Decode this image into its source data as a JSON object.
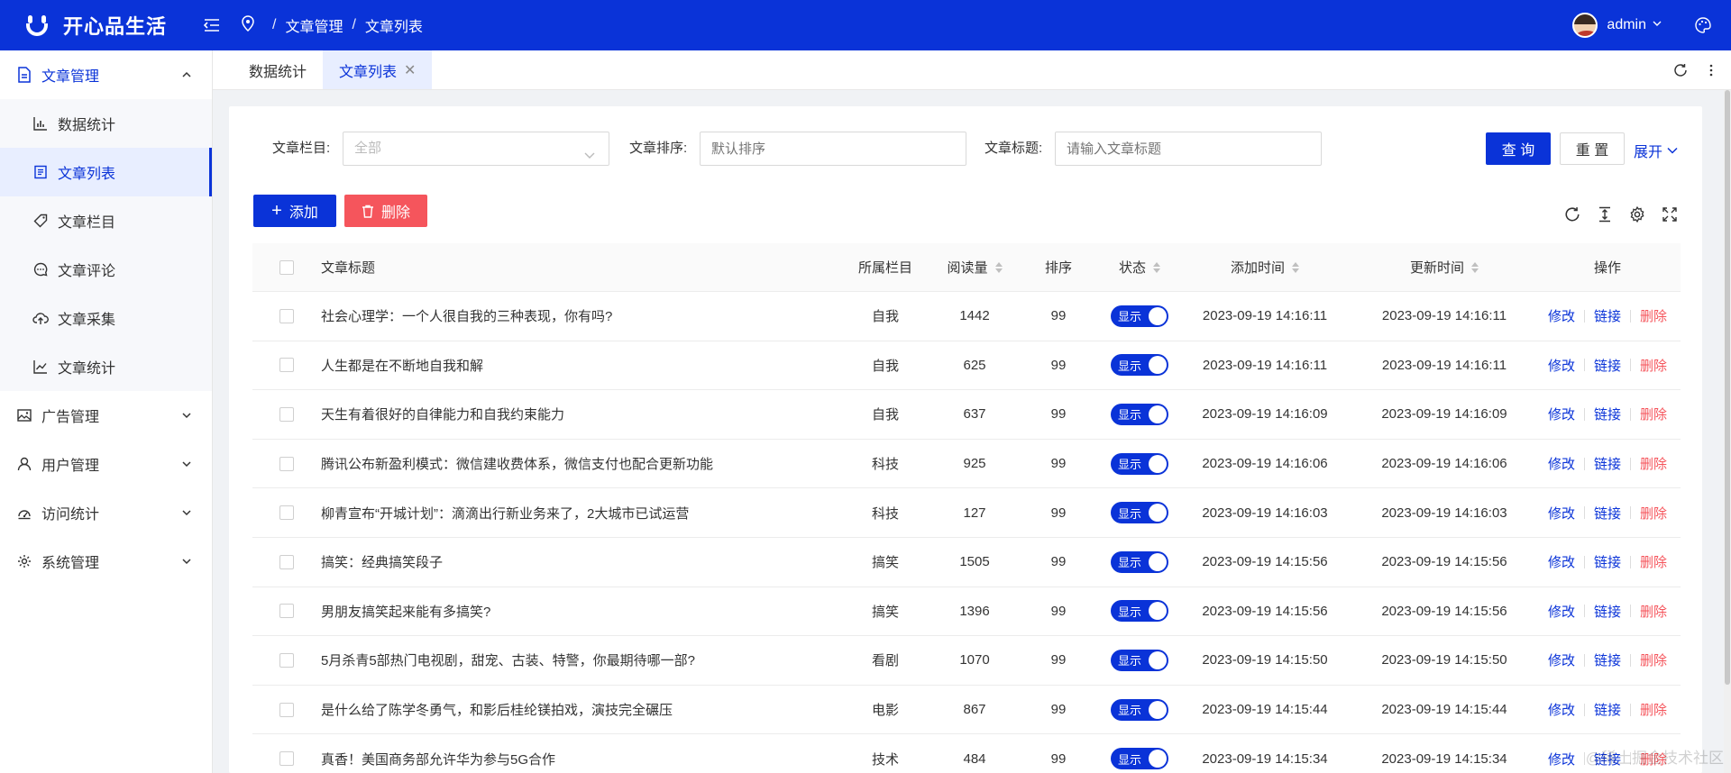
{
  "app": {
    "logo_text": "开心品生活",
    "breadcrumb": [
      "文章管理",
      "文章列表"
    ],
    "user": "admin"
  },
  "colors": {
    "primary": "#0a33d8",
    "danger": "#f5555c"
  },
  "sidebar": {
    "groups": [
      {
        "label": "文章管理",
        "icon": "document-icon",
        "open": true,
        "items": [
          {
            "label": "数据统计",
            "icon": "bar-chart-icon"
          },
          {
            "label": "文章列表",
            "icon": "list-icon",
            "active": true
          },
          {
            "label": "文章栏目",
            "icon": "tag-icon"
          },
          {
            "label": "文章评论",
            "icon": "comment-icon"
          },
          {
            "label": "文章采集",
            "icon": "cloud-upload-icon"
          },
          {
            "label": "文章统计",
            "icon": "line-chart-icon"
          }
        ]
      },
      {
        "label": "广告管理",
        "icon": "image-icon"
      },
      {
        "label": "用户管理",
        "icon": "user-icon"
      },
      {
        "label": "访问统计",
        "icon": "dashboard-icon"
      },
      {
        "label": "系统管理",
        "icon": "gear-icon"
      }
    ]
  },
  "tabs": [
    {
      "label": "数据统计"
    },
    {
      "label": "文章列表",
      "active": true
    }
  ],
  "filter": {
    "column_label": "文章栏目:",
    "column_value": "全部",
    "sort_label": "文章排序:",
    "sort_placeholder": "默认排序",
    "title_label": "文章标题:",
    "title_placeholder": "请输入文章标题",
    "query": "查 询",
    "reset": "重 置",
    "expand": "展开"
  },
  "toolbar": {
    "add": "添加",
    "delete": "删除"
  },
  "table": {
    "headers": {
      "title": "文章标题",
      "category": "所属栏目",
      "reads": "阅读量",
      "sort": "排序",
      "status": "状态",
      "added": "添加时间",
      "updated": "更新时间",
      "ops": "操作"
    },
    "status_label": "显示",
    "op_edit": "修改",
    "op_link": "链接",
    "op_delete": "删除",
    "rows": [
      {
        "title": "社会心理学：一个人很自我的三种表现，你有吗?",
        "category": "自我",
        "reads": "1442",
        "sort": "99",
        "added": "2023-09-19 14:16:11",
        "updated": "2023-09-19 14:16:11"
      },
      {
        "title": "人生都是在不断地自我和解",
        "category": "自我",
        "reads": "625",
        "sort": "99",
        "added": "2023-09-19 14:16:11",
        "updated": "2023-09-19 14:16:11"
      },
      {
        "title": "天生有着很好的自律能力和自我约束能力",
        "category": "自我",
        "reads": "637",
        "sort": "99",
        "added": "2023-09-19 14:16:09",
        "updated": "2023-09-19 14:16:09"
      },
      {
        "title": "腾讯公布新盈利模式：微信建收费体系，微信支付也配合更新功能",
        "category": "科技",
        "reads": "925",
        "sort": "99",
        "added": "2023-09-19 14:16:06",
        "updated": "2023-09-19 14:16:06"
      },
      {
        "title": "柳青宣布“开城计划”：滴滴出行新业务来了，2大城市已试运营",
        "category": "科技",
        "reads": "127",
        "sort": "99",
        "added": "2023-09-19 14:16:03",
        "updated": "2023-09-19 14:16:03"
      },
      {
        "title": "搞笑：经典搞笑段子",
        "category": "搞笑",
        "reads": "1505",
        "sort": "99",
        "added": "2023-09-19 14:15:56",
        "updated": "2023-09-19 14:15:56"
      },
      {
        "title": "男朋友搞笑起来能有多搞笑?",
        "category": "搞笑",
        "reads": "1396",
        "sort": "99",
        "added": "2023-09-19 14:15:56",
        "updated": "2023-09-19 14:15:56"
      },
      {
        "title": "5月杀青5部热门电视剧，甜宠、古装、特警，你最期待哪一部?",
        "category": "看剧",
        "reads": "1070",
        "sort": "99",
        "added": "2023-09-19 14:15:50",
        "updated": "2023-09-19 14:15:50"
      },
      {
        "title": "是什么给了陈学冬勇气，和影后桂纶镁拍戏，演技完全碾压",
        "category": "电影",
        "reads": "867",
        "sort": "99",
        "added": "2023-09-19 14:15:44",
        "updated": "2023-09-19 14:15:44"
      },
      {
        "title": "真香！美国商务部允许华为参与5G合作",
        "category": "技术",
        "reads": "484",
        "sort": "99",
        "added": "2023-09-19 14:15:34",
        "updated": "2023-09-19 14:15:34"
      }
    ]
  },
  "watermark": "@稀土掘金技术社区"
}
